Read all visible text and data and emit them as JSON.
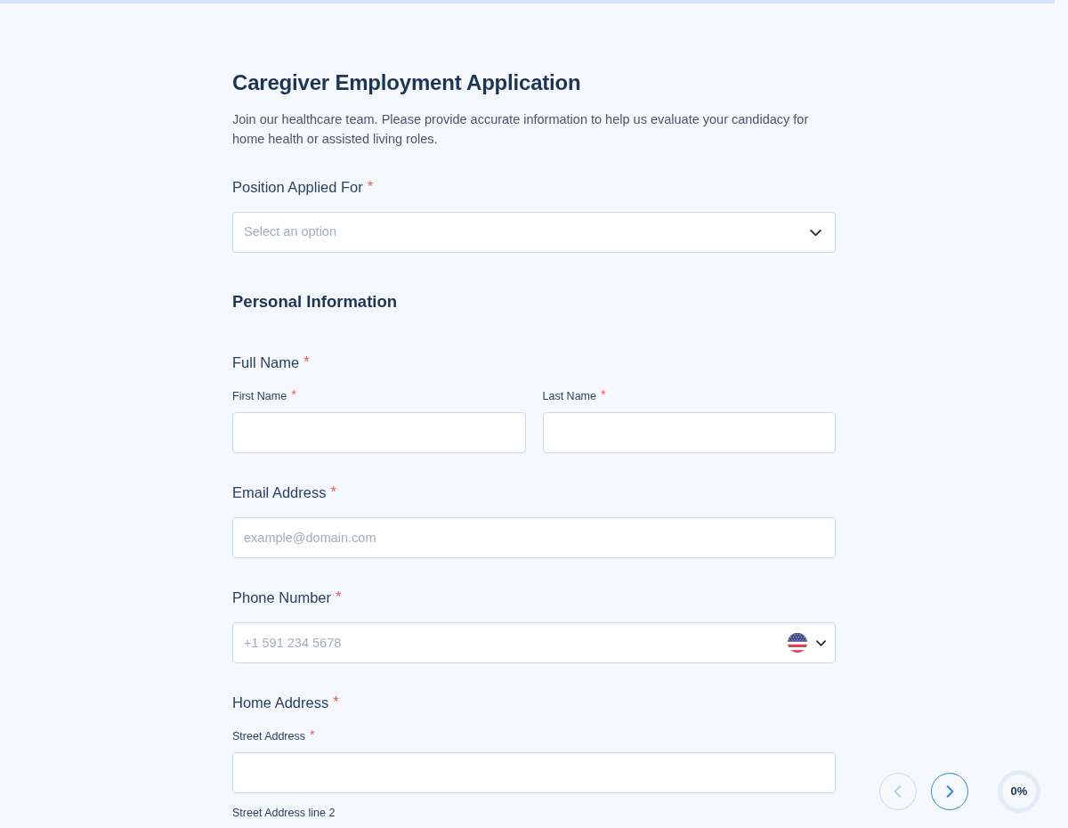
{
  "progress": {
    "level": 0,
    "reading": "0%"
  },
  "form": {
    "title": "Caregiver Employment Application",
    "description": "Join our healthcare team. Please provide accurate information to help us evaluate your candidacy for home health or assisted living roles.",
    "items": [
      {
        "kind": "select",
        "label": "Position Applied For",
        "required_mark": "*",
        "placeholder": "Select an option"
      },
      {
        "kind": "heading",
        "text": "Personal Information"
      },
      {
        "kind": "pair",
        "label": "Full Name",
        "required_mark": "*",
        "fields": [
          {
            "kind": "text",
            "label": "First Name",
            "required_mark": "*"
          },
          {
            "kind": "text",
            "label": "Last Name",
            "required_mark": "*"
          }
        ]
      },
      {
        "kind": "email",
        "label": "Email Address",
        "required_mark": "*",
        "placeholder": "example@domain.com"
      },
      {
        "kind": "phone",
        "label": "Phone Number",
        "required_mark": "*",
        "placeholder": "+1 591 234 5678"
      },
      {
        "kind": "stack",
        "label": "Home Address",
        "required_mark": "*",
        "fields": [
          {
            "kind": "text",
            "label": "Street Address",
            "required_mark": "*"
          },
          {
            "kind": "label",
            "label": "Street Address line 2"
          }
        ]
      }
    ]
  },
  "navigation": [
    {
      "kind": "previous",
      "disabled": true
    },
    {
      "kind": "next",
      "disabled": false
    }
  ]
}
